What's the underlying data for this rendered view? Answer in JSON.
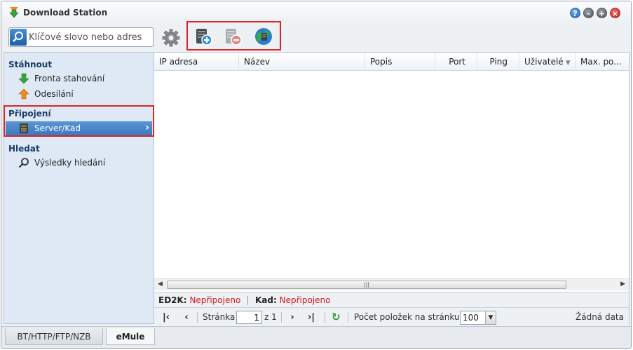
{
  "window": {
    "title": "Download Station",
    "colors": {
      "accent": "#3c79bd",
      "highlight": "#d9262c",
      "status_error": "#d8161b"
    }
  },
  "toolbar": {
    "search_placeholder": "Klíčové slovo nebo adres",
    "icons": [
      "settings-icon",
      "add-server-icon",
      "remove-server-icon",
      "globe-icon"
    ]
  },
  "sidebar": {
    "sections": [
      {
        "title": "Stáhnout",
        "items": [
          {
            "label": "Fronta stahování",
            "icon": "download-arrow-icon"
          },
          {
            "label": "Odesílání",
            "icon": "upload-arrow-icon"
          }
        ]
      },
      {
        "title": "Připojení",
        "items": [
          {
            "label": "Server/Kad",
            "icon": "server-icon",
            "active": true
          }
        ]
      },
      {
        "title": "Hledat",
        "items": [
          {
            "label": "Výsledky hledání",
            "icon": "magnifier-icon"
          }
        ]
      }
    ]
  },
  "grid": {
    "columns": [
      "IP adresa",
      "Název",
      "Popis",
      "Port",
      "Ping",
      "Uživatelé",
      "Max. po..."
    ],
    "rows": []
  },
  "status": {
    "ed2k_label": "ED2K:",
    "ed2k_value": "Nepřipojeno",
    "kad_label": "Kad:",
    "kad_value": "Nepřipojeno"
  },
  "pager": {
    "page_label": "Stránka",
    "page_value": "1",
    "of_label": "z 1",
    "per_page_label": "Počet položek na stránku:",
    "per_page_value": "100",
    "no_data": "Žádná data"
  },
  "bottom_tabs": [
    {
      "label": "BT/HTTP/FTP/NZB"
    },
    {
      "label": "eMule",
      "selected": true
    }
  ]
}
